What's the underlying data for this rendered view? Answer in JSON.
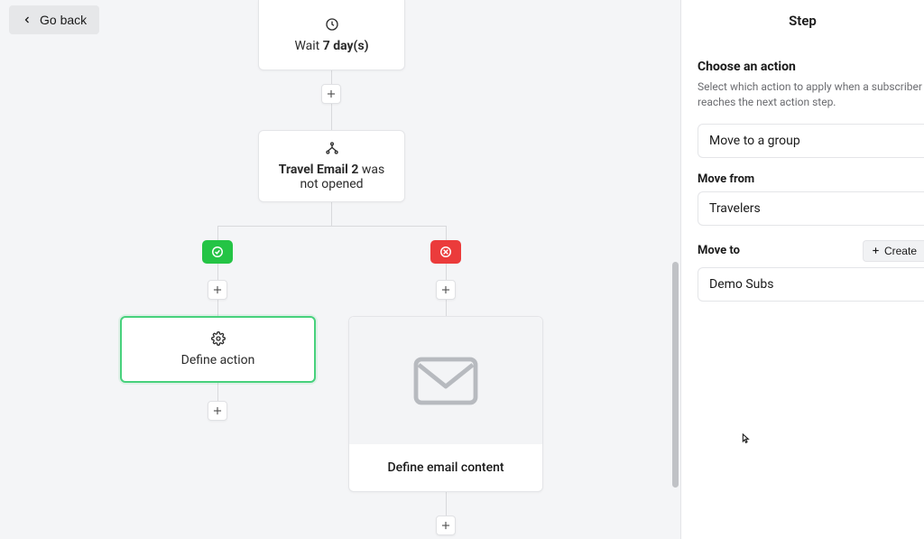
{
  "header": {
    "go_back": "Go back"
  },
  "nodes": {
    "wait": {
      "prefix": "Wait ",
      "bold": "7 day(s)",
      "suffix": ""
    },
    "condition": {
      "bold": "Travel Email 2",
      "suffix": " was not opened"
    },
    "define_action": "Define action",
    "define_email": "Define email content"
  },
  "panel": {
    "title": "Step",
    "choose_title": "Choose an action",
    "choose_desc": "Select which action to apply when a subscriber reaches the next action step.",
    "action_select": "Move to a group",
    "move_from_label": "Move from",
    "move_from_value": "Travelers",
    "move_to_label": "Move to",
    "create_btn": "Create",
    "move_to_value": "Demo Subs"
  }
}
